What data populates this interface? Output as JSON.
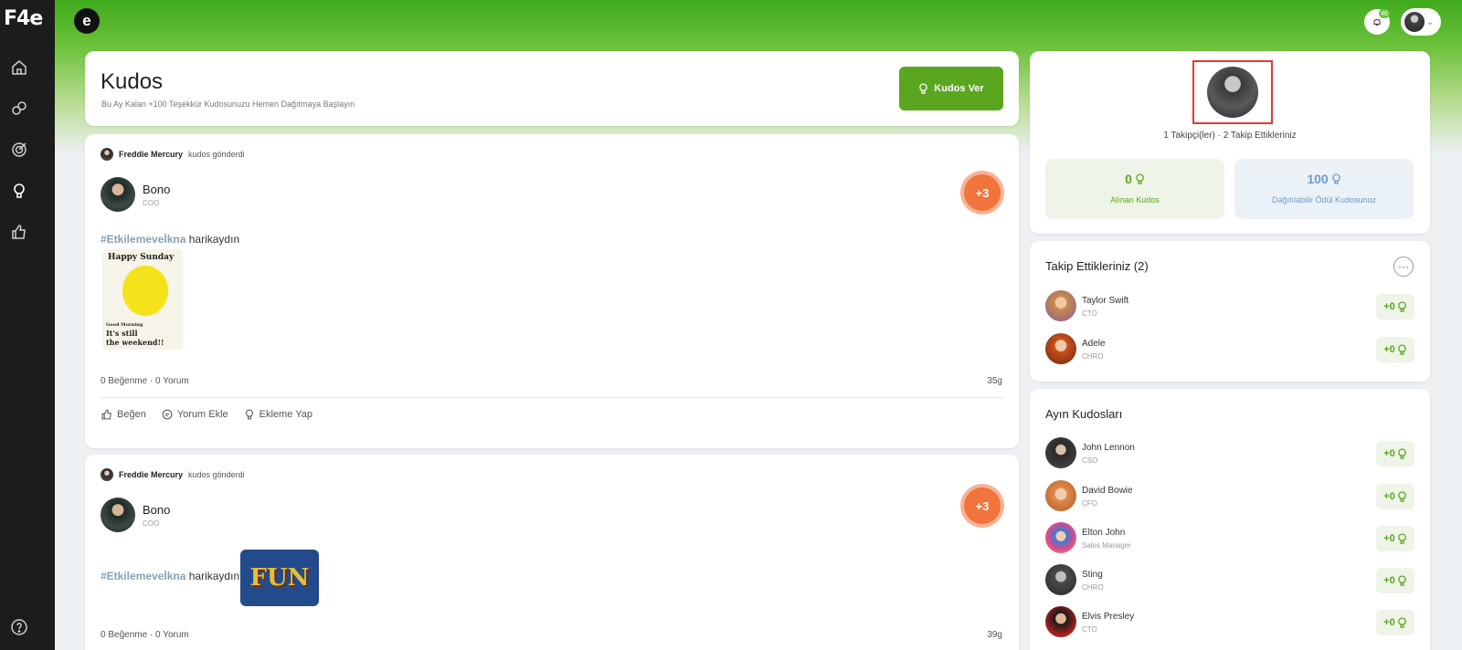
{
  "sidebar": {
    "logo": "F4e",
    "nav": [
      "home",
      "community",
      "goals",
      "kudos",
      "likes",
      "help"
    ]
  },
  "topbar": {
    "brand_letter": "e",
    "notification_count": "46"
  },
  "header": {
    "title": "Kudos",
    "subtitle": "Bu Ay Kalan +100 Teşekkür Kudosunuzu Hemen Dağıtmaya Başlayın",
    "button_label": "Kudos Ver"
  },
  "posts": [
    {
      "sender": "Freddie Mercury",
      "action": "kudos gönderdi",
      "recipient": "Bono",
      "recipient_role": "COO",
      "points": "+3",
      "tag": "#Etkilemeveİkna",
      "message": "harikaydın",
      "gif_top": "Happy Sunday",
      "gif_bottom_small": "Good Morning",
      "gif_bottom_1": "It's still",
      "gif_bottom_2": "the weekend!!",
      "stats": "0 Beğenme · 0 Yorum",
      "age": "35g",
      "actions": [
        "Beğen",
        "Yorum Ekle",
        "Ekleme Yap"
      ]
    },
    {
      "sender": "Freddie Mercury",
      "action": "kudos gönderdi",
      "recipient": "Bono",
      "recipient_role": "COO",
      "points": "+3",
      "tag": "#Etkilemeveİkna",
      "message": "harikaydın",
      "gif_text": "FUN",
      "stats": "0 Beğenme · 0 Yorum",
      "age": "39g"
    }
  ],
  "profile": {
    "followers_text": "1 Takipçi(ler) · 2 Takip Ettikleriniz",
    "received_value": "0",
    "received_label": "Alınan Kudos",
    "distributable_value": "100",
    "distributable_label": "Dağıtılabilir Ödül Kudosunuz"
  },
  "following": {
    "title": "Takip Ettikleriniz (2)",
    "more": "···",
    "people": [
      {
        "name": "Taylor Swift",
        "role": "CTO",
        "kudos": "+0"
      },
      {
        "name": "Adele",
        "role": "CHRO",
        "kudos": "+0"
      }
    ]
  },
  "month": {
    "title": "Ayın Kudosları",
    "people": [
      {
        "name": "John Lennon",
        "role": "CSO",
        "kudos": "+0"
      },
      {
        "name": "David Bowie",
        "role": "CFO",
        "kudos": "+0"
      },
      {
        "name": "Elton John",
        "role": "Sales Manager",
        "kudos": "+0"
      },
      {
        "name": "Sting",
        "role": "CHRO",
        "kudos": "+0"
      },
      {
        "name": "Elvis Presley",
        "role": "CTO",
        "kudos": "+0"
      }
    ]
  },
  "colors": {
    "brand_green": "#5aa61f",
    "badge_orange": "#f0743b",
    "sidebar": "#1c1c1c",
    "highlight_red": "#e53935"
  }
}
